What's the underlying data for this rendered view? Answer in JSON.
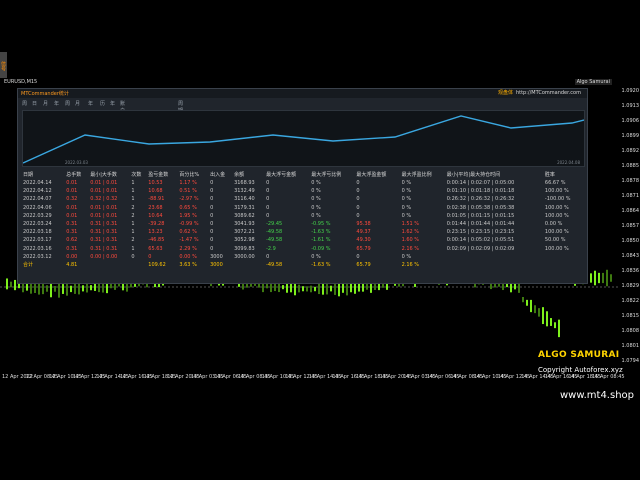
{
  "chart": {
    "symbol_label": "EURUSD,M15",
    "badge": "Algo Samurai",
    "price_labels": [
      "1.0920",
      "1.0913",
      "1.0906",
      "1.0899",
      "1.0892",
      "1.0885",
      "1.0878",
      "1.0871",
      "1.0864",
      "1.0857",
      "1.0850",
      "1.0843",
      "1.0836",
      "1.0829",
      "1.0822",
      "1.0815",
      "1.0808",
      "1.0801",
      "1.0794"
    ],
    "time_labels": [
      "12 Apr 2022",
      "12 Apr 08:45",
      "12 Apr 10:45",
      "12 Apr 12:45",
      "12 Apr 14:45",
      "12 Apr 16:45",
      "12 Apr 18:45",
      "12 Apr 20:45",
      "13 Apr 03:45",
      "13 Apr 06:45",
      "13 Apr 08:45",
      "13 Apr 10:45",
      "13 Apr 12:45",
      "13 Apr 14:45",
      "13 Apr 16:45",
      "13 Apr 18:45",
      "13 Apr 20:45",
      "14 Apr 03:45",
      "14 Apr 06:45",
      "14 Apr 08:45",
      "14 Apr 10:45",
      "14 Apr 12:45",
      "14 Apr 14:45",
      "14 Apr 16:45",
      "14 Apr 18:45",
      "15 Apr 08:45"
    ],
    "sidetab": "信号",
    "algo_title": "ALGO SAMURAI",
    "algo_copyright": "Copyright   Autoforex.xyz",
    "watermark": "www.mt4.shop"
  },
  "panel": {
    "logo": "MTCommander统计",
    "link_label": "观盘体",
    "link_url": "http://MTCommander.com",
    "toolbar": [
      "周",
      "日",
      "月",
      "年",
      "周",
      "月",
      "年",
      "历",
      "年",
      "账户",
      "",
      "周期"
    ],
    "mini_dates": [
      "2022.03.03",
      "2022.04.08"
    ],
    "columns": [
      "日期",
      "总手数",
      "最小|大手数",
      "次数",
      "盈亏金数",
      "百分比%",
      "出入金",
      "余额",
      "最大浮亏金额",
      "最大浮亏比例",
      "最大浮盈金额",
      "最大浮盈比例",
      "最小|平均|最大持仓时间",
      "胜率"
    ],
    "rows": [
      [
        "2022.04.14",
        "0.01",
        "0.01 | 0.01",
        "1",
        "10.53",
        "1.17 %",
        "0",
        "3168.93",
        "0",
        "0 %",
        "0",
        "0 %",
        "0:00:14 | 0:02:07 | 0:05:00",
        "66.67 %"
      ],
      [
        "2022.04.12",
        "0.01",
        "0.01 | 0.01",
        "1",
        "10.68",
        "0.51 %",
        "0",
        "3132.49",
        "0",
        "0 %",
        "0",
        "0 %",
        "0:01:10 | 0:01:18 | 0:01:18",
        "100.00 %"
      ],
      [
        "2022.04.07",
        "0.32",
        "0.32 | 0.32",
        "1",
        "-88.91",
        "-2.97 %",
        "0",
        "3116.40",
        "0",
        "0 %",
        "0",
        "0 %",
        "0:26:32 | 0:26:32 | 0:26:32",
        "-100.00 %"
      ],
      [
        "2022.04.06",
        "0.01",
        "0.01 | 0.01",
        "2",
        "23.68",
        "0.65 %",
        "0",
        "3179.31",
        "0",
        "0 %",
        "0",
        "0 %",
        "0:02:38 | 0:05:38 | 0:05:38",
        "100.00 %"
      ],
      [
        "2022.03.29",
        "0.01",
        "0.01 | 0.01",
        "2",
        "10.64",
        "1.95 %",
        "0",
        "3089.62",
        "0",
        "0 %",
        "0",
        "0 %",
        "0:01:05 | 0:01:15 | 0:01:15",
        "100.00 %"
      ],
      [
        "2022.03.24",
        "0.31",
        "0.31 | 0.31",
        "1",
        "-39.28",
        "-0.99 %",
        "0",
        "3041.93",
        "-29.45",
        "-0.95 %",
        "95.38",
        "1.51 %",
        "0:01:44 | 0:01:44 | 0:01:44",
        "0.00 %"
      ],
      [
        "2022.03.18",
        "0.31",
        "0.31 | 0.31",
        "1",
        "13.23",
        "0.62 %",
        "0",
        "3072.21",
        "-49.58",
        "-1.63 %",
        "49.37",
        "1.62 %",
        "0:23:15 | 0:23:15 | 0:23:15",
        "100.00 %"
      ],
      [
        "2022.03.17",
        "0.62",
        "0.31 | 0.31",
        "2",
        "-46.85",
        "-1.47 %",
        "0",
        "3052.98",
        "-49.58",
        "-1.61 %",
        "49.30",
        "1.60 %",
        "0:00:14 | 0:05:02 | 0:05:51",
        "50.00 %"
      ],
      [
        "2022.03.16",
        "0.31",
        "0.31 | 0.31",
        "1",
        "65.63",
        "2.29 %",
        "0",
        "3099.83",
        "-2.9",
        "-0.09 %",
        "65.79",
        "2.16 %",
        "0:02:09 | 0:02:09 | 0:02:09",
        "100.00 %"
      ],
      [
        "2022.03.12",
        "0.00",
        "0.00 | 0.00",
        "0",
        "0",
        "0.00 %",
        "3000",
        "3000.00",
        "0",
        "0 %",
        "0",
        "0 %",
        "",
        ""
      ]
    ],
    "total": [
      "合计",
      "4.81",
      "",
      "",
      "109.62",
      "3.63 %",
      "3000",
      "",
      "-49.58",
      "-1.63 %",
      "65.79",
      "2.16 %",
      "",
      ""
    ]
  },
  "colors": {
    "background": "#000000",
    "panel": "#20252c",
    "accent": "#ff9a1e",
    "line": "#3aa7e0",
    "candles": "#7ef01c",
    "loss": "#ff4a3d",
    "gain": "#44d34b",
    "total": "#ffc400"
  }
}
